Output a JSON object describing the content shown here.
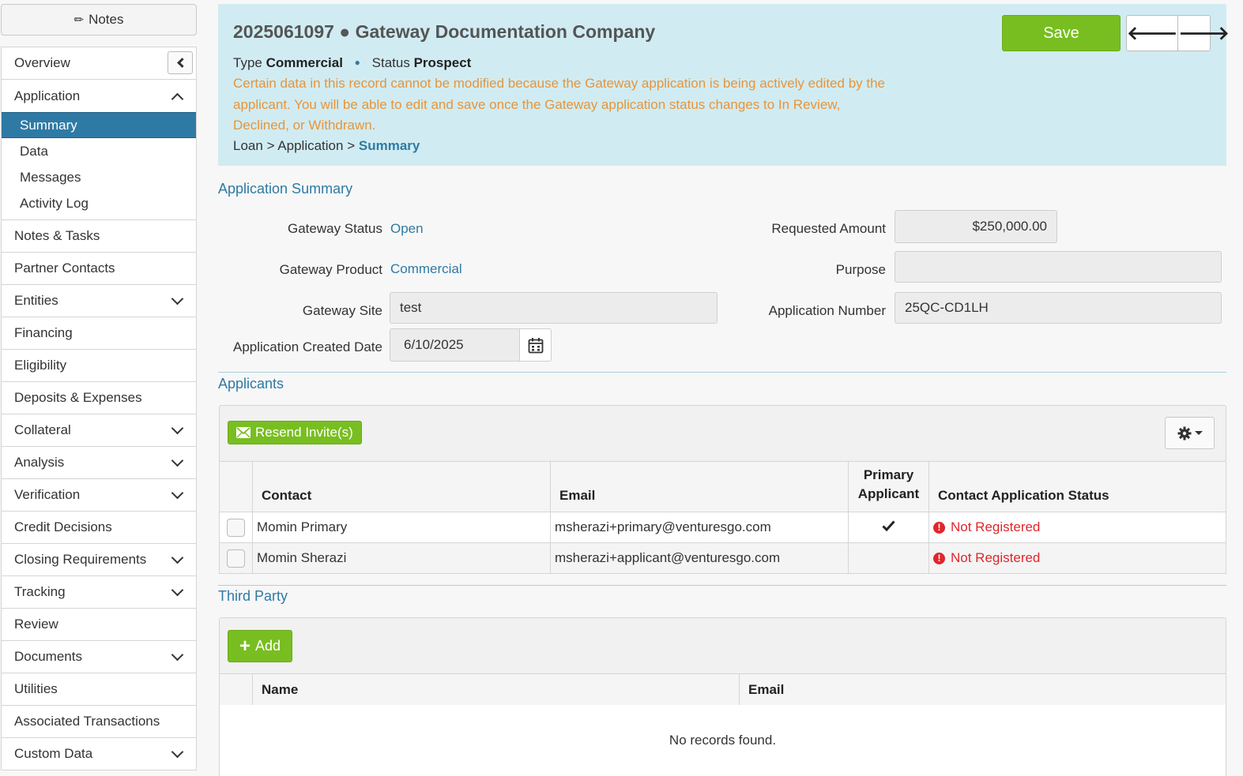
{
  "sidebar": {
    "notes_label": "Notes",
    "overview": "Overview",
    "application": "Application",
    "sub_items": [
      "Summary",
      "Data",
      "Messages",
      "Activity Log"
    ],
    "items": [
      {
        "label": "Notes & Tasks",
        "chevron": false
      },
      {
        "label": "Partner Contacts",
        "chevron": false
      },
      {
        "label": "Entities",
        "chevron": true
      },
      {
        "label": "Financing",
        "chevron": false
      },
      {
        "label": "Eligibility",
        "chevron": false
      },
      {
        "label": "Deposits & Expenses",
        "chevron": false
      },
      {
        "label": "Collateral",
        "chevron": true
      },
      {
        "label": "Analysis",
        "chevron": true
      },
      {
        "label": "Verification",
        "chevron": true
      },
      {
        "label": "Credit Decisions",
        "chevron": false
      },
      {
        "label": "Closing Requirements",
        "chevron": true
      },
      {
        "label": "Tracking",
        "chevron": true
      },
      {
        "label": "Review",
        "chevron": false
      },
      {
        "label": "Documents",
        "chevron": true
      },
      {
        "label": "Utilities",
        "chevron": false
      },
      {
        "label": "Associated Transactions",
        "chevron": false
      },
      {
        "label": "Custom Data",
        "chevron": true
      }
    ]
  },
  "header": {
    "title": "2025061097 ● Gateway Documentation Company",
    "type_label": "Type",
    "type_value": "Commercial",
    "status_label": "Status",
    "status_value": "Prospect",
    "warning": "Certain data in this record cannot be modified because the Gateway application is being actively edited by the applicant. You will be able to edit and save once the Gateway application status changes to In Review, Declined, or Withdrawn.",
    "breadcrumb": {
      "loan": "Loan",
      "sep": ">",
      "application": "Application",
      "current": "Summary"
    },
    "save_label": "Save"
  },
  "summary": {
    "section_title": "Application Summary",
    "gateway_status_label": "Gateway Status",
    "gateway_status_value": "Open",
    "gateway_product_label": "Gateway Product",
    "gateway_product_value": "Commercial",
    "gateway_site_label": "Gateway Site",
    "gateway_site_value": "test",
    "created_date_label": "Application Created Date",
    "created_date_value": "6/10/2025",
    "requested_amount_label": "Requested Amount",
    "requested_amount_value": "$250,000.00",
    "purpose_label": "Purpose",
    "purpose_value": "",
    "app_number_label": "Application Number",
    "app_number_value": "25QC-CD1LH"
  },
  "applicants": {
    "section_title": "Applicants",
    "resend_label": "Resend Invite(s)",
    "columns": {
      "contact": "Contact",
      "email": "Email",
      "primary_line1": "Primary",
      "primary_line2": "Applicant",
      "status": "Contact Application Status"
    },
    "rows": [
      {
        "contact": "Momin Primary",
        "email": "msherazi+primary@venturesgo.com",
        "primary": true,
        "status": "Not Registered"
      },
      {
        "contact": "Momin Sherazi",
        "email": "msherazi+applicant@venturesgo.com",
        "primary": false,
        "status": "Not Registered"
      }
    ]
  },
  "third_party": {
    "section_title": "Third Party",
    "add_label": "Add",
    "columns": {
      "name": "Name",
      "email": "Email"
    },
    "empty_text": "No records found."
  },
  "colors": {
    "accent": "#2f7aa4",
    "success": "#78be20",
    "warning": "#e8943a",
    "error": "#e0262c",
    "header_bg": "#d0ecf2"
  }
}
